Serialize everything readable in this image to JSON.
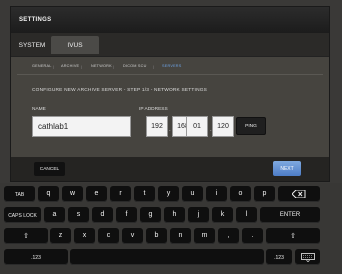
{
  "dialog": {
    "title": "SETTINGS",
    "tabs": {
      "system": "SYSTEM",
      "ivus": "IVUS"
    },
    "sub_tabs": [
      "GENERAL",
      "ARCHIVE",
      "NETWORK",
      "DICOM SCU",
      "SERVERS"
    ],
    "separator": "|",
    "step_title": "CONFIGURE NEW ARCHIVE SERVER - STEP 1/3 - NETWORK SETTINGS",
    "name": {
      "label": "NAME",
      "value": "cathlab1"
    },
    "ip": {
      "label": "IP ADDRESS",
      "octets": [
        "192",
        "168",
        "01",
        "120"
      ],
      "dot": "."
    },
    "ping_label": "PING",
    "cancel_label": "CANCEL",
    "next_label": "NEXT"
  },
  "keyboard": {
    "tab": "TAB",
    "row1": [
      "q",
      "w",
      "e",
      "r",
      "t",
      "y",
      "u",
      "i",
      "o",
      "p"
    ],
    "caps": "CAPS LOCK",
    "row2": [
      "a",
      "s",
      "d",
      "f",
      "g",
      "h",
      "j",
      "k",
      "l"
    ],
    "enter": "ENTER",
    "shift": "⇧",
    "row3": [
      "z",
      "x",
      "c",
      "v",
      "b",
      "n",
      "m",
      ",",
      "."
    ],
    "num": ".123"
  },
  "colors": {
    "active_subtab": "#6ea4e6",
    "next_button": "#5b86cc"
  }
}
